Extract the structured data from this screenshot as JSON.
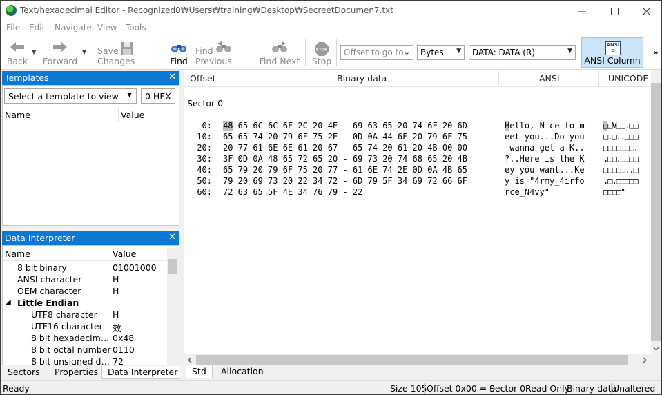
{
  "window": {
    "title": "Text/hexadecimal Editor - Recognized0₩Users₩training₩Desktop₩SecreetDocumen7.txt",
    "controls": {
      "minimize": "—",
      "maximize": "☐",
      "close": "✕"
    }
  },
  "menu": [
    "File",
    "Edit",
    "Navigate",
    "View",
    "Tools"
  ],
  "toolbar": {
    "back": "Back",
    "forward": "Forward",
    "save_changes": "Save Changes",
    "find": "Find",
    "find_previous": "Find Previous",
    "find_next": "Find Next",
    "stop": "Stop",
    "stop_icon_text": "STOP",
    "offset_placeholder": "Offset to go to",
    "unit": "Bytes",
    "data_select": "DATA: DATA (R)",
    "ansi_column": "ANSI Column",
    "ansi_icon_text": "ANSI",
    "more": "»"
  },
  "templates": {
    "title": "Templates",
    "select": "Select a template to view",
    "offset_box": "0 HEX",
    "columns": [
      "Name",
      "Value"
    ]
  },
  "data_interpreter": {
    "title": "Data Interpreter",
    "columns": [
      "Name",
      "Value"
    ],
    "rows": [
      {
        "name": "8 bit binary",
        "value": "01001000"
      },
      {
        "name": "ANSI character",
        "value": "H"
      },
      {
        "name": "OEM character",
        "value": "H"
      },
      {
        "name": "Little Endian",
        "value": ""
      },
      {
        "name": "UTF8 character",
        "value": "H"
      },
      {
        "name": "UTF16 character",
        "value": "效"
      },
      {
        "name": "8 bit hexadecimal ...",
        "value": "0x48"
      },
      {
        "name": "8 bit octal number",
        "value": "0110"
      },
      {
        "name": "8 bit unsigned dec...",
        "value": "72"
      }
    ],
    "group_toggle": "◢"
  },
  "left_tabs": [
    "Sectors",
    "Properties",
    "Data Interpreter"
  ],
  "hex_view": {
    "columns": {
      "offset": "Offset",
      "binary": "Binary data",
      "ansi": "ANSI",
      "unicode": "UNICODE"
    },
    "sector": "Sector 0",
    "rows": [
      {
        "offset": "0:",
        "first": "48",
        "hex": " 65 6C 6C 6F 2C 20 4E - 69 63 65 20 74 6F 20 6D",
        "ansi_first": "H",
        "ansi": "ello, Nice to m",
        "unicode_first": "□",
        "unicode": "□Ɐ□□.□□"
      },
      {
        "offset": "10:",
        "first": "",
        "hex": "65 65 74 20 79 6F 75 2E - 0D 0A 44 6F 20 79 6F 75",
        "ansi_first": "",
        "ansi": "eet you...Do you",
        "unicode_first": "",
        "unicode": "□.□..□□□"
      },
      {
        "offset": "20:",
        "first": "",
        "hex": "20 77 61 6E 6E 61 20 67 - 65 74 20 61 20 4B 00 00",
        "ansi_first": "",
        "ansi": " wanna get a K..",
        "unicode_first": "",
        "unicode": "□□□□□□□."
      },
      {
        "offset": "30:",
        "first": "",
        "hex": "3F 0D 0A 48 65 72 65 20 - 69 73 20 74 68 65 20 4B",
        "ansi_first": "",
        "ansi": "?..Here is the K",
        "unicode_first": "",
        "unicode": ".□□.□□□□"
      },
      {
        "offset": "40:",
        "first": "",
        "hex": "65 79 20 79 6F 75 20 77 - 61 6E 74 2E 0D 0A 4B 65",
        "ansi_first": "",
        "ansi": "ey you want...Ke",
        "unicode_first": "",
        "unicode": "□□□□□..□"
      },
      {
        "offset": "50:",
        "first": "",
        "hex": "79 20 69 73 20 22 34 72 - 6D 79 5F 34 69 72 66 6F",
        "ansi_first": "",
        "ansi": "y is \"4rmy_4irfo",
        "unicode_first": "",
        "unicode": ".□.□□□□□"
      },
      {
        "offset": "60:",
        "first": "",
        "hex": "72 63 65 5F 4E 34 76 79 - 22",
        "ansi_first": "",
        "ansi": "rce_N4vy\"",
        "unicode_first": "",
        "unicode": "□□□□\""
      }
    ]
  },
  "hex_tabs": [
    "Std",
    "Allocation"
  ],
  "status": {
    "ready": "Ready",
    "size": "Size 105",
    "offset": "Offset 0x00 = 0",
    "sector": "Sector 0",
    "mode": "Read Only",
    "data": "Binary data",
    "state": "Unaltered"
  }
}
